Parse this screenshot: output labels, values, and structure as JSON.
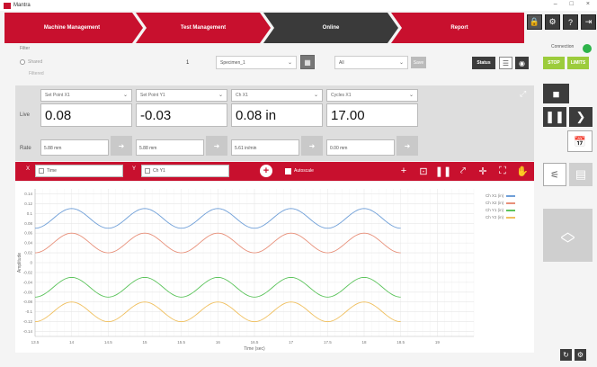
{
  "window": {
    "title": "Mantra"
  },
  "workflow": {
    "steps": [
      "Machine Management",
      "Test Management",
      "Online",
      "Report"
    ]
  },
  "filter": {
    "label": "Filter",
    "radio_label": "Shared",
    "sub_label": "Filtered",
    "specimen_number": "1",
    "specimen_select": "Specimen_1",
    "all_select": "All",
    "save_label": "Save",
    "status_label": "Status"
  },
  "connection": {
    "label": "Connection",
    "status_color": "#2db34a"
  },
  "controls": {
    "stop_label": "STOP",
    "limits_label": "LIMITS"
  },
  "live": {
    "live_label": "Live",
    "rate_label": "Rate",
    "tiles": [
      {
        "select": "Set Point X1",
        "value": "0.08",
        "rate": "5.88 mm"
      },
      {
        "select": "Set Point Y1",
        "value": "-0.03",
        "rate": "5.88 mm"
      },
      {
        "select": "Ch X1",
        "value": "0.08 in",
        "rate": "5.61 in/min"
      },
      {
        "select": "Cycles X1",
        "value": "17.00",
        "rate": "0.00 mm"
      }
    ]
  },
  "graph_toolbar": {
    "x_label": "X",
    "x_field": "Time",
    "y_label": "Y",
    "y_field": "Ch Y1",
    "autoscale_label": "Autoscale"
  },
  "chart_data": {
    "type": "line",
    "xlabel": "Time (sec)",
    "ylabel": "Amplitude",
    "xlim": [
      13.5,
      19.5
    ],
    "ylim": [
      -0.15,
      0.15
    ],
    "x_ticks": [
      "13.5",
      "14",
      "14.5",
      "15",
      "15.5",
      "16",
      "16.5",
      "17",
      "17.5",
      "18",
      "18.5",
      "19"
    ],
    "y_ticks": [
      "0.14",
      "0.12",
      "0.1",
      "0.08",
      "0.06",
      "0.04",
      "0.02",
      "0",
      "-0.02",
      "-0.04",
      "-0.06",
      "-0.08",
      "-0.1",
      "-0.12",
      "-0.14"
    ],
    "series": [
      {
        "name": "Ch X1 (in)",
        "color": "#6f9fd8",
        "offset": 0.09,
        "amplitude": 0.02,
        "period": 1.0,
        "phase": 0.0
      },
      {
        "name": "Ch X2 (in)",
        "color": "#e8907a",
        "offset": 0.04,
        "amplitude": 0.02,
        "period": 1.0,
        "phase": 0.0
      },
      {
        "name": "Ch Y1 (in)",
        "color": "#5cc45c",
        "offset": -0.05,
        "amplitude": 0.02,
        "period": 1.0,
        "phase": 0.0
      },
      {
        "name": "Ch Y2 (in)",
        "color": "#f0c060",
        "offset": -0.1,
        "amplitude": 0.02,
        "period": 1.0,
        "phase": 0.0
      }
    ],
    "grid": true,
    "legend": "top-right"
  }
}
